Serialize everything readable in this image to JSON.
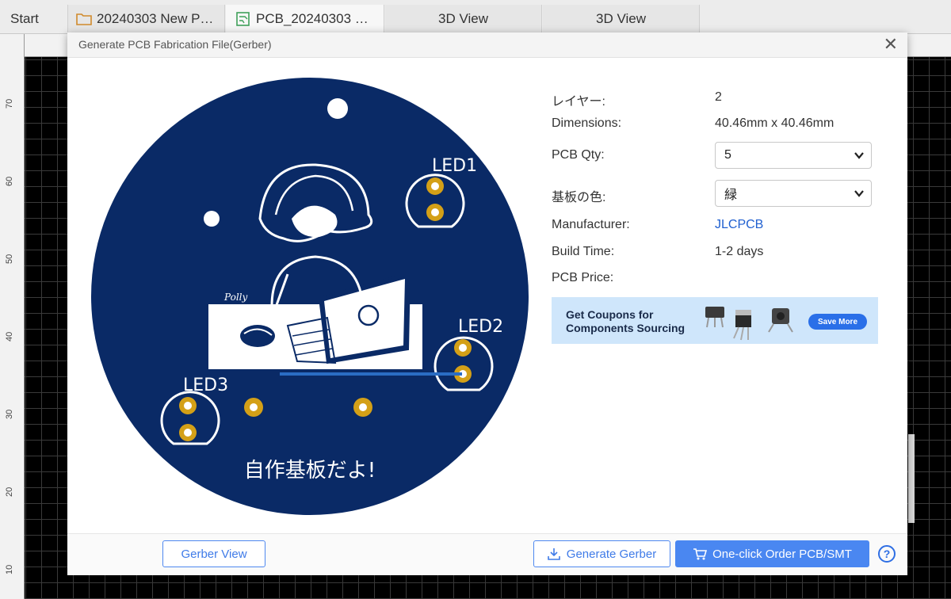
{
  "tabs": [
    {
      "label": "Start"
    },
    {
      "label": "20240303 New P…"
    },
    {
      "label": "PCB_20240303 …"
    },
    {
      "label": "3D View"
    },
    {
      "label": "3D View"
    }
  ],
  "ruler": {
    "left_labels": [
      "70",
      "60",
      "50",
      "40",
      "30",
      "20",
      "10"
    ]
  },
  "dialog": {
    "title": "Generate PCB Fabrication File(Gerber)",
    "close_symbol": "✕",
    "pcb": {
      "board_color": "#0a2a66",
      "silkscreen": {
        "led1": "LED1",
        "led2": "LED2",
        "led3": "LED3",
        "caption": "自作基板だよ!",
        "signature": "Polly"
      }
    },
    "info": {
      "layers_label": "レイヤー:",
      "layers_value": "2",
      "dimensions_label": "Dimensions:",
      "dimensions_value": "40.46mm x 40.46mm",
      "qty_label": "PCB Qty:",
      "qty_value": "5",
      "color_label": "基板の色:",
      "color_value": "緑",
      "manufacturer_label": "Manufacturer:",
      "manufacturer_value": "JLCPCB",
      "build_time_label": "Build Time:",
      "build_time_value": "1-2 days",
      "price_label": "PCB Price:"
    },
    "banner": {
      "line1": "Get Coupons for",
      "line2": "Components Sourcing",
      "button": "Save More"
    },
    "footer": {
      "gerber_view": "Gerber View",
      "generate_gerber": "Generate Gerber",
      "order": "One-click Order PCB/SMT",
      "help": "?"
    }
  },
  "colors": {
    "accent": "#4a87f1",
    "link": "#1f5fd0",
    "pad": "#d4a017"
  }
}
